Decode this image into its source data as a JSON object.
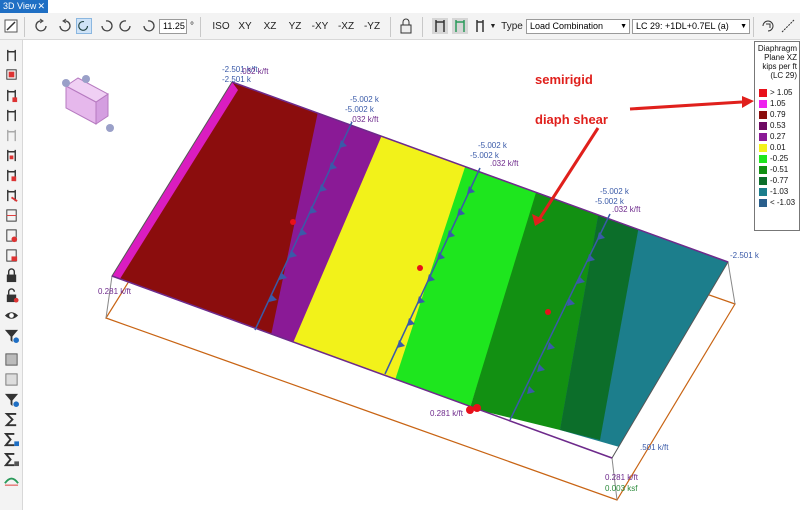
{
  "tab": {
    "title": "3D View",
    "close": "✕"
  },
  "toolbar": {
    "zoom_value": "11.25",
    "degree_symbol": "°",
    "views": [
      "ISO",
      "XY",
      "XZ",
      "YZ",
      "-XY",
      "-XZ",
      "-YZ"
    ],
    "type_label": "Type",
    "type_value": "Load Combination",
    "combo_value": "LC 29: +1DL+0.7EL (a)"
  },
  "legend": {
    "title_lines": [
      "Diaphragm",
      "Plane XZ",
      "kips per ft",
      "(LC 29)"
    ],
    "entries": [
      {
        "label": "> 1.05",
        "color": "#e8101a"
      },
      {
        "label": "1.05",
        "color": "#ee22ee"
      },
      {
        "label": "0.79",
        "color": "#8b0d0d"
      },
      {
        "label": "0.53",
        "color": "#6e0a63"
      },
      {
        "label": "0.27",
        "color": "#8a1a96"
      },
      {
        "label": "0.01",
        "color": "#f2f21a"
      },
      {
        "label": "-0.25",
        "color": "#1ee61e"
      },
      {
        "label": "-0.51",
        "color": "#129012"
      },
      {
        "label": "-0.77",
        "color": "#0c6e2a"
      },
      {
        "label": "-1.03",
        "color": "#1c7e8c"
      },
      {
        "label": "< -1.03",
        "color": "#2a5f8c"
      }
    ]
  },
  "annotations": {
    "semirigid": "semirigid",
    "diaph_shear": "diaph shear"
  },
  "model_labels": {
    "load_k": "-5.002 k",
    "load_kft": ".032 k/ft",
    "edge_kft": "-2.501 k/ft",
    "edge_k": "-2.501 k",
    "base_kft": "0.281 k/ft",
    "base_ksf": "0.003 ksf",
    "small_kft": ".501 k/ft"
  },
  "colors": {
    "accent": "#1f6fc4",
    "arrow": "#e0201c"
  }
}
